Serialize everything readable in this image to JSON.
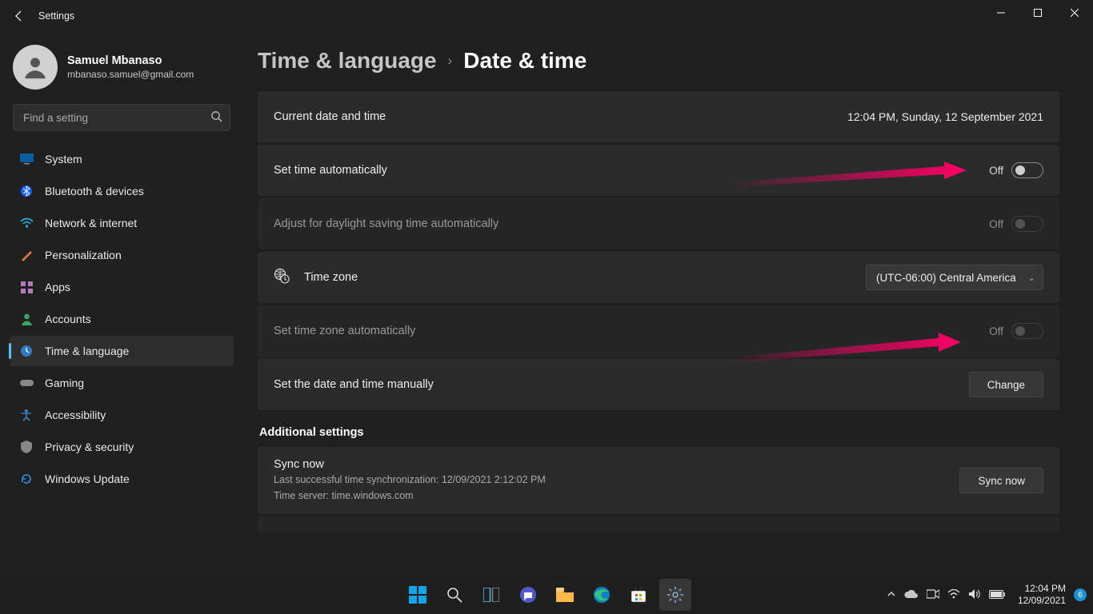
{
  "titlebar": {
    "title": "Settings"
  },
  "profile": {
    "name": "Samuel Mbanaso",
    "email": "mbanaso.samuel@gmail.com"
  },
  "search": {
    "placeholder": "Find a setting"
  },
  "nav": [
    {
      "label": "System",
      "icon": "🖥️"
    },
    {
      "label": "Bluetooth & devices",
      "icon": "bt"
    },
    {
      "label": "Network & internet",
      "icon": "📶"
    },
    {
      "label": "Personalization",
      "icon": "🖌️"
    },
    {
      "label": "Apps",
      "icon": "▦"
    },
    {
      "label": "Accounts",
      "icon": "👤"
    },
    {
      "label": "Time & language",
      "icon": "🕒"
    },
    {
      "label": "Gaming",
      "icon": "🎮"
    },
    {
      "label": "Accessibility",
      "icon": "♿"
    },
    {
      "label": "Privacy & security",
      "icon": "🛡️"
    },
    {
      "label": "Windows Update",
      "icon": "🔄"
    }
  ],
  "breadcrumbs": {
    "parent": "Time & language",
    "current": "Date & time"
  },
  "rows": {
    "current": {
      "label": "Current date and time",
      "value": "12:04 PM, Sunday, 12 September 2021"
    },
    "auto_time": {
      "label": "Set time automatically",
      "state": "Off"
    },
    "dst": {
      "label": "Adjust for daylight saving time automatically",
      "state": "Off"
    },
    "timezone": {
      "label": "Time zone",
      "value": "(UTC-06:00) Central America"
    },
    "auto_tz": {
      "label": "Set time zone automatically",
      "state": "Off"
    },
    "manual": {
      "label": "Set the date and time manually",
      "button": "Change"
    }
  },
  "additional": {
    "title": "Additional settings",
    "sync": {
      "title": "Sync now",
      "line1": "Last successful time synchronization: 12/09/2021 2:12:02 PM",
      "line2": "Time server: time.windows.com",
      "button": "Sync now"
    }
  },
  "taskbar": {
    "clock_time": "12:04 PM",
    "clock_date": "12/09/2021",
    "notif_count": "6"
  }
}
